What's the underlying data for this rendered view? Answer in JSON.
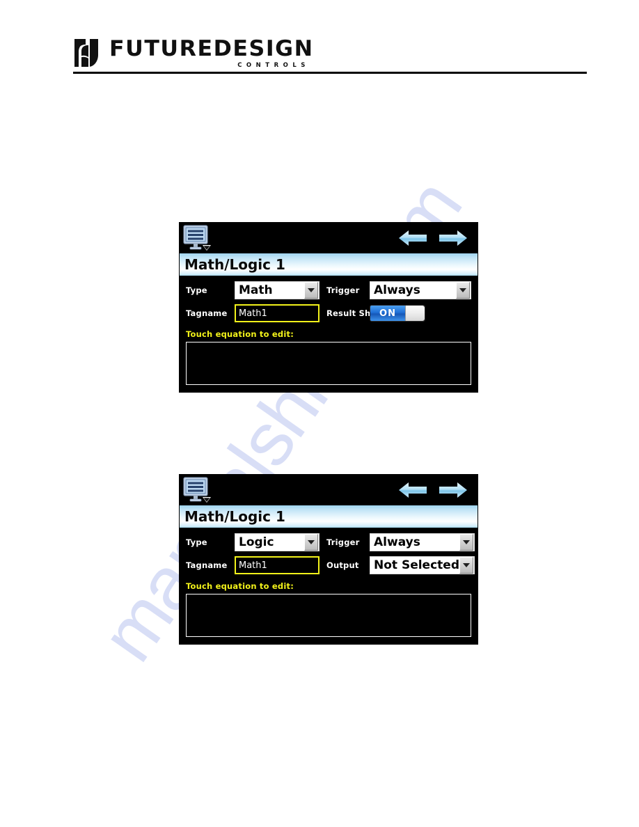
{
  "brand": {
    "name": "FUTUREDESIGN",
    "tagline": "CONTROLS",
    "logo_icon": "futuredesign-logo-mark"
  },
  "watermark": {
    "text": "manualshive.com",
    "color": "#b9c4ef"
  },
  "colors": {
    "panel_background": "#000000",
    "title_bar_accent": "#9fd4ef",
    "field_highlight": "#f2f21a",
    "toggle_on": "#1f6fd6",
    "label_text": "#ffffff"
  },
  "panels": [
    {
      "id": "math-logic-panel-1",
      "toolbar": {
        "menu_icon": "monitor-menu-icon",
        "back_icon": "arrow-left-icon",
        "next_icon": "arrow-right-icon"
      },
      "title": "Math/Logic 1",
      "fields": {
        "type_label": "Type",
        "type_value": "Math",
        "trigger_label": "Trigger",
        "trigger_value": "Always",
        "tagname_label": "Tagname",
        "tagname_value": "Math1",
        "right2_label": "Result Shown",
        "right2_kind": "toggle",
        "right2_value": "ON"
      },
      "hint": "Touch equation to edit:",
      "equation_value": ""
    },
    {
      "id": "math-logic-panel-2",
      "toolbar": {
        "menu_icon": "monitor-menu-icon",
        "back_icon": "arrow-left-icon",
        "next_icon": "arrow-right-icon"
      },
      "title": "Math/Logic 1",
      "fields": {
        "type_label": "Type",
        "type_value": "Logic",
        "trigger_label": "Trigger",
        "trigger_value": "Always",
        "tagname_label": "Tagname",
        "tagname_value": "Math1",
        "right2_label": "Output",
        "right2_kind": "select",
        "right2_value": "Not Selected"
      },
      "hint": "Touch equation to edit:",
      "equation_value": ""
    }
  ]
}
